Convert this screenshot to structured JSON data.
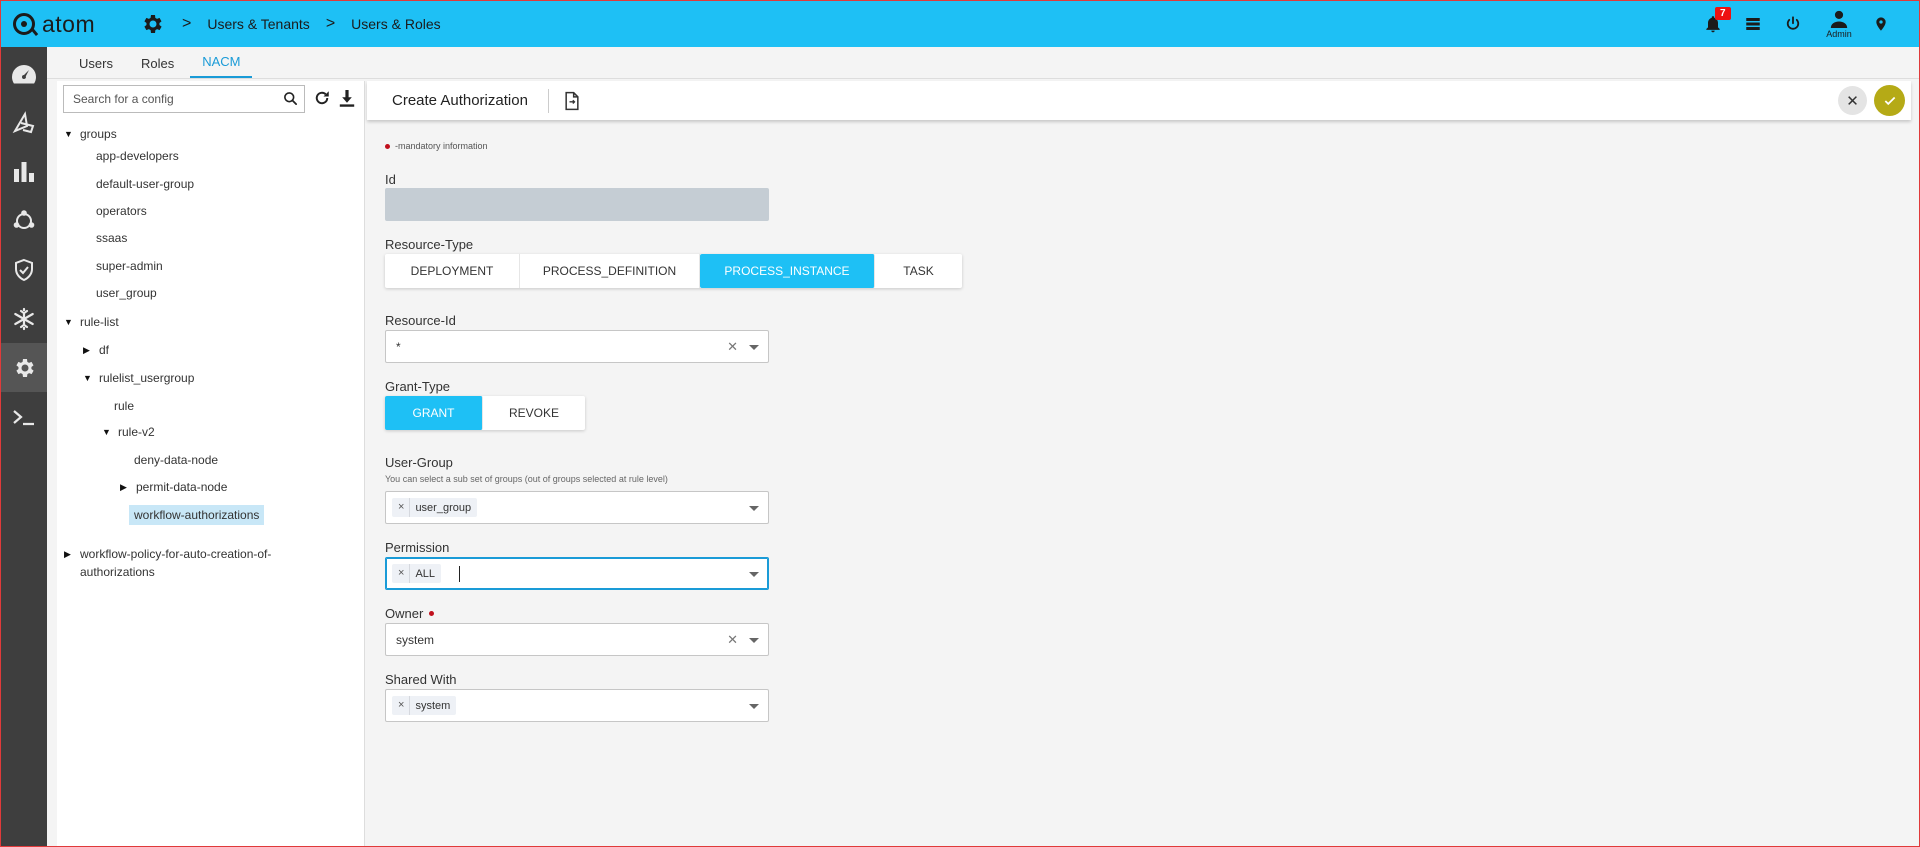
{
  "app": {
    "logo_text": "atom"
  },
  "breadcrumb": [
    "Users & Tenants",
    "Users & Roles"
  ],
  "notifications": {
    "count": "7"
  },
  "user": {
    "label": "Admin"
  },
  "subtabs": [
    {
      "label": "Users",
      "active": false
    },
    {
      "label": "Roles",
      "active": false
    },
    {
      "label": "NACM",
      "active": true
    }
  ],
  "tree": {
    "search_placeholder": "Search for a config",
    "nodes": {
      "groups": "groups",
      "app_developers": "app-developers",
      "default_user_group": "default-user-group",
      "operators": "operators",
      "ssaas": "ssaas",
      "super_admin": "super-admin",
      "user_group": "user_group",
      "rule_list": "rule-list",
      "df": "df",
      "rulelist_usergroup": "rulelist_usergroup",
      "rule": "rule",
      "rule_v2": "rule-v2",
      "deny_data_node": "deny-data-node",
      "permit_data_node": "permit-data-node",
      "workflow_authorizations": "workflow-authorizations",
      "workflow_policy_line1": "workflow-policy-for-auto-creation-of-",
      "workflow_policy_line2": "authorizations"
    }
  },
  "form": {
    "title": "Create Authorization",
    "mandatory_note": "-mandatory information",
    "id": {
      "label": "Id"
    },
    "resource_type": {
      "label": "Resource-Type",
      "options": [
        "DEPLOYMENT",
        "PROCESS_DEFINITION",
        "PROCESS_INSTANCE",
        "TASK"
      ],
      "selected": "PROCESS_INSTANCE"
    },
    "resource_id": {
      "label": "Resource-Id",
      "value": "*"
    },
    "grant_type": {
      "label": "Grant-Type",
      "options": [
        "GRANT",
        "REVOKE"
      ],
      "selected": "GRANT"
    },
    "user_group": {
      "label": "User-Group",
      "hint": "You can select a sub set of groups (out of groups selected at rule level)",
      "chip": "user_group"
    },
    "permission": {
      "label": "Permission",
      "chip": "ALL"
    },
    "owner": {
      "label": "Owner",
      "value": "system"
    },
    "shared_with": {
      "label": "Shared With",
      "chip": "system"
    }
  },
  "colors": {
    "topbar": "#1ec0f5",
    "rail": "#3e3e3e",
    "accent": "#1a9bd7",
    "confirm": "#b5aa16",
    "badge": "#e11111"
  }
}
